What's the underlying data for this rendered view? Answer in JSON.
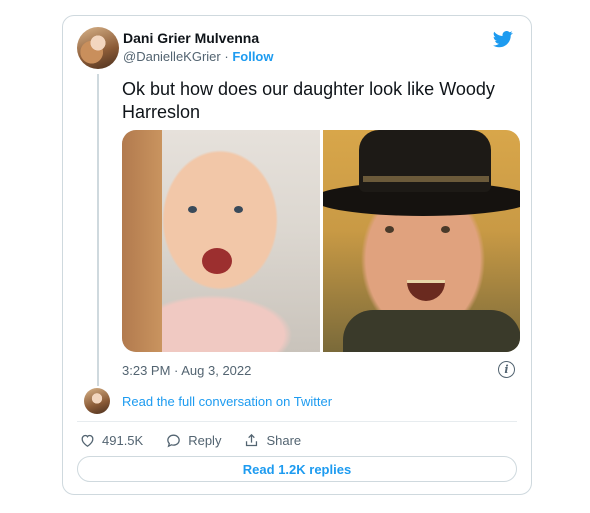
{
  "tweet": {
    "author_name": "Dani Grier Mulvenna",
    "handle": "@DanielleKGrier",
    "separator": "·",
    "follow_label": "Follow",
    "text": "Ok but how does our daughter look like Woody Harreslon",
    "timestamp": "3:23 PM · Aug 3, 2022",
    "info_glyph": "i",
    "conversation_link": "Read the full conversation on Twitter",
    "likes_count": "491.5K",
    "reply_label": "Reply",
    "share_label": "Share",
    "read_replies_label": "Read 1.2K replies"
  },
  "icons": {
    "brand": "twitter-bird-icon",
    "like": "heart-icon",
    "reply": "speech-bubble-icon",
    "share": "share-upload-icon",
    "info": "info-icon"
  },
  "colors": {
    "accent": "#1d9bf0",
    "text": "#0f1419",
    "secondary_text": "#536471",
    "border": "#cfd9de"
  }
}
